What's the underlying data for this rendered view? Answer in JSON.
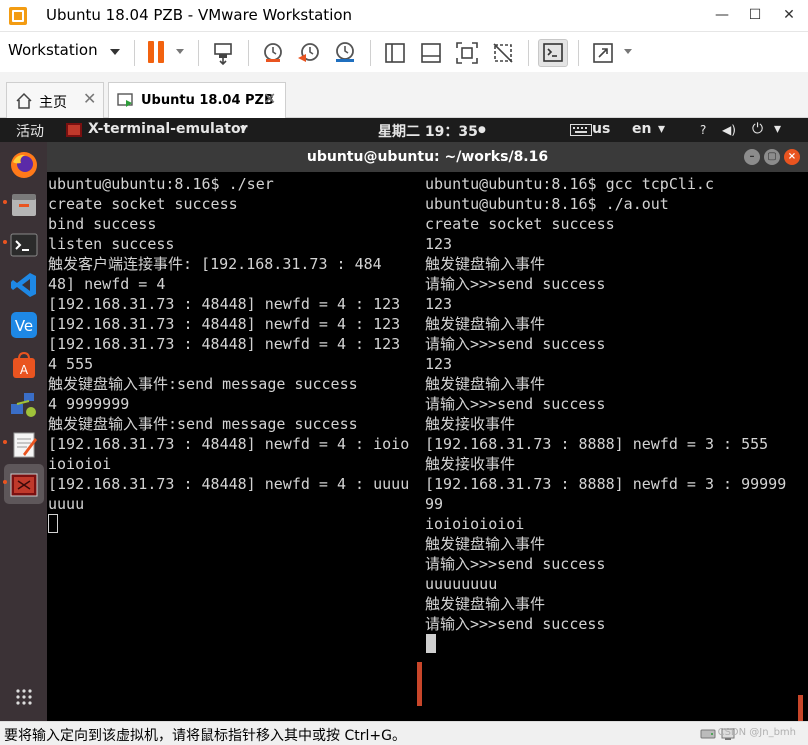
{
  "window": {
    "title": "Ubuntu 18.04 PZB - VMware Workstation",
    "minimize": "—",
    "maximize": "☐",
    "close": "✕"
  },
  "toolbar": {
    "workstation_label": "Workstation"
  },
  "tabs": [
    {
      "label": "主页",
      "close": "✕"
    },
    {
      "label": "Ubuntu 18.04 PZB",
      "close": "✕"
    }
  ],
  "ubuntu_topbar": {
    "activities": "活动",
    "app_name": "X-terminal-emulator",
    "app_caret": "▾",
    "clock": "星期二 19：35",
    "clock_dot": "●",
    "keyboard": "us",
    "language": "en",
    "lang_caret": "▾",
    "help": "?",
    "volume": "◀)",
    "power": "⏻",
    "power_caret": "▾"
  },
  "terminal": {
    "title": "ubuntu@ubuntu: ~/works/8.16",
    "left_lines": [
      "ubuntu@ubuntu:8.16$ ./ser",
      "create socket success",
      "bind success",
      "listen success",
      "触发客户端连接事件: [192.168.31.73 : 484",
      "48] newfd = 4",
      "[192.168.31.73 : 48448] newfd = 4 : 123",
      "[192.168.31.73 : 48448] newfd = 4 : 123",
      "[192.168.31.73 : 48448] newfd = 4 : 123",
      "4 555",
      "触发键盘输入事件:send message success",
      "4 9999999",
      "触发键盘输入事件:send message success",
      "[192.168.31.73 : 48448] newfd = 4 : ioio",
      "ioioioi",
      "[192.168.31.73 : 48448] newfd = 4 : uuuu",
      "uuuu"
    ],
    "right_lines": [
      "ubuntu@ubuntu:8.16$ gcc tcpCli.c",
      "ubuntu@ubuntu:8.16$ ./a.out",
      "create socket success",
      "123",
      "触发键盘输入事件",
      "请输入>>>send success",
      "123",
      "触发键盘输入事件",
      "请输入>>>send success",
      "123",
      "触发键盘输入事件",
      "请输入>>>send success",
      "触发接收事件",
      "[192.168.31.73 : 8888] newfd = 3 : 555",
      "触发接收事件",
      "[192.168.31.73 : 8888] newfd = 3 : 99999",
      "99",
      "ioioioioioi",
      "触发键盘输入事件",
      "请输入>>>send success",
      "uuuuuuuu",
      "触发键盘输入事件",
      "请输入>>>send success"
    ]
  },
  "statusbar": {
    "message": "要将输入定向到该虚拟机，请将鼠标指针移入其中或按 Ctrl+G。",
    "watermark": "CSDN @Jn_bmh"
  },
  "colors": {
    "ubuntu_orange": "#e95420",
    "pause_orange": "#f2620f",
    "terminal_bg": "#000000",
    "terminal_fg": "#d3d3d3"
  }
}
